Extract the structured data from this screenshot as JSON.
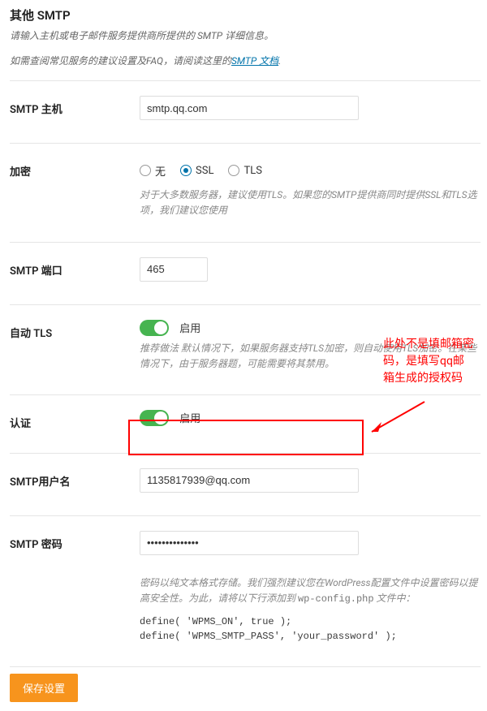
{
  "header": {
    "title": "其他 SMTP",
    "subtitle": "请输入主机或电子邮件服务提供商所提供的 SMTP 详细信息。",
    "faq_prefix": "如需查阅常见服务的建议设置及FAQ，请阅读这里的",
    "faq_link": "SMTP 文档",
    "faq_suffix": "."
  },
  "rows": {
    "host": {
      "label": "SMTP 主机",
      "value": "smtp.qq.com"
    },
    "encryption": {
      "label": "加密",
      "opt_none": "无",
      "opt_ssl": "SSL",
      "opt_tls": "TLS",
      "selected": "ssl",
      "help": "对于大多数服务器，建议使用TLS。如果您的SMTP提供商同时提供SSL和TLS选项，我们建议您使用"
    },
    "port": {
      "label": "SMTP 端口",
      "value": "465"
    },
    "autotls": {
      "label": "自动 TLS",
      "toggle_label": "启用",
      "help": "推荐做法 默认情况下，如果服务器支持TLS加密，则自动使用TLS加密。在某些情况下，由于服务器题，可能需要将其禁用。"
    },
    "auth": {
      "label": "认证",
      "toggle_label": "启用"
    },
    "user": {
      "label": "SMTP用户名",
      "value": "1135817939@qq.com"
    },
    "pass": {
      "label": "SMTP 密码",
      "value": "••••••••••••••",
      "help1": "密码以纯文本格式存储。我们强烈建议您在WordPress配置文件中设置密码以提高安全性。为此，请将以下行添加到 ",
      "help_code": "wp-config.php",
      "help2": " 文件中：",
      "code": "define( 'WPMS_ON', true );\ndefine( 'WPMS_SMTP_PASS', 'your_password' );"
    }
  },
  "callout": {
    "text": "此处不是填邮箱密码，是填写qq邮箱生成的授权码"
  },
  "actions": {
    "save": "保存设置"
  }
}
